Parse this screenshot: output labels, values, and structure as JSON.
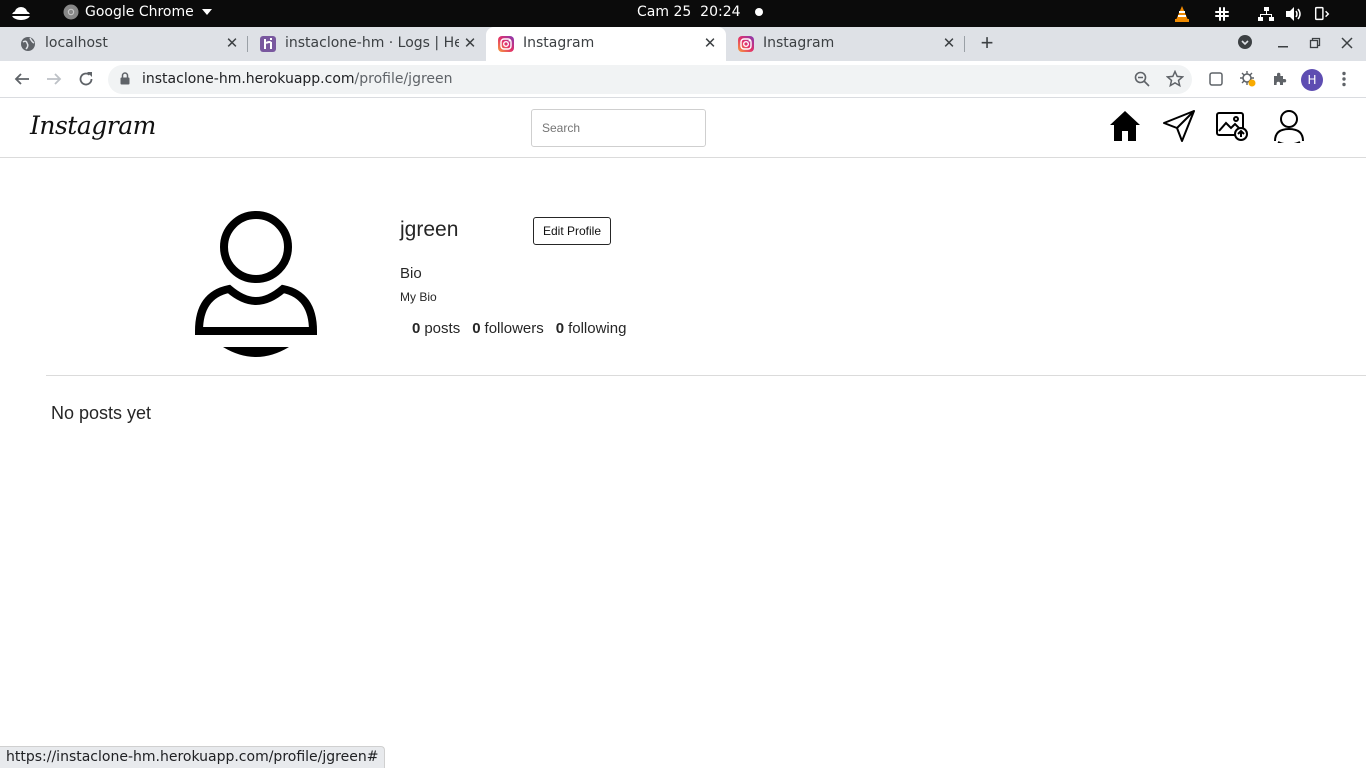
{
  "os_bar": {
    "app_name": "Google Chrome",
    "clock": "Cam 25  20:24"
  },
  "tabs": [
    {
      "title": "localhost",
      "favicon": "globe-icon"
    },
    {
      "title": "instaclone-hm · Logs | Her",
      "favicon": "heroku-icon"
    },
    {
      "title": "Instagram",
      "favicon": "instagram-icon",
      "active": true
    },
    {
      "title": "Instagram",
      "favicon": "instagram-icon"
    }
  ],
  "toolbar": {
    "url_host": "instaclone-hm.herokuapp.com",
    "url_path": "/profile/jgreen",
    "profile_initial": "H"
  },
  "header": {
    "logo": "Instagram",
    "search_placeholder": "Search",
    "nav_icons": [
      "home-icon",
      "send-icon",
      "image-upload-icon",
      "user-icon"
    ]
  },
  "profile": {
    "username": "jgreen",
    "edit_button": "Edit Profile",
    "bio_label": "Bio",
    "bio_text": "My Bio",
    "stats": {
      "posts_count": "0",
      "posts_label": "posts",
      "followers_count": "0",
      "followers_label": "followers",
      "following_count": "0",
      "following_label": "following"
    }
  },
  "posts": {
    "empty_message": "No posts yet"
  },
  "status_bar": {
    "link": "https://instaclone-hm.herokuapp.com/profile/jgreen#"
  },
  "colors": {
    "topbar_bg": "#0b0b0b",
    "tabstrip_bg": "#dee1e6",
    "omnibox_bg": "#f1f3f4",
    "avatar_bg": "#5e4db2",
    "text": "#262626",
    "divider": "#dbdbdb"
  }
}
